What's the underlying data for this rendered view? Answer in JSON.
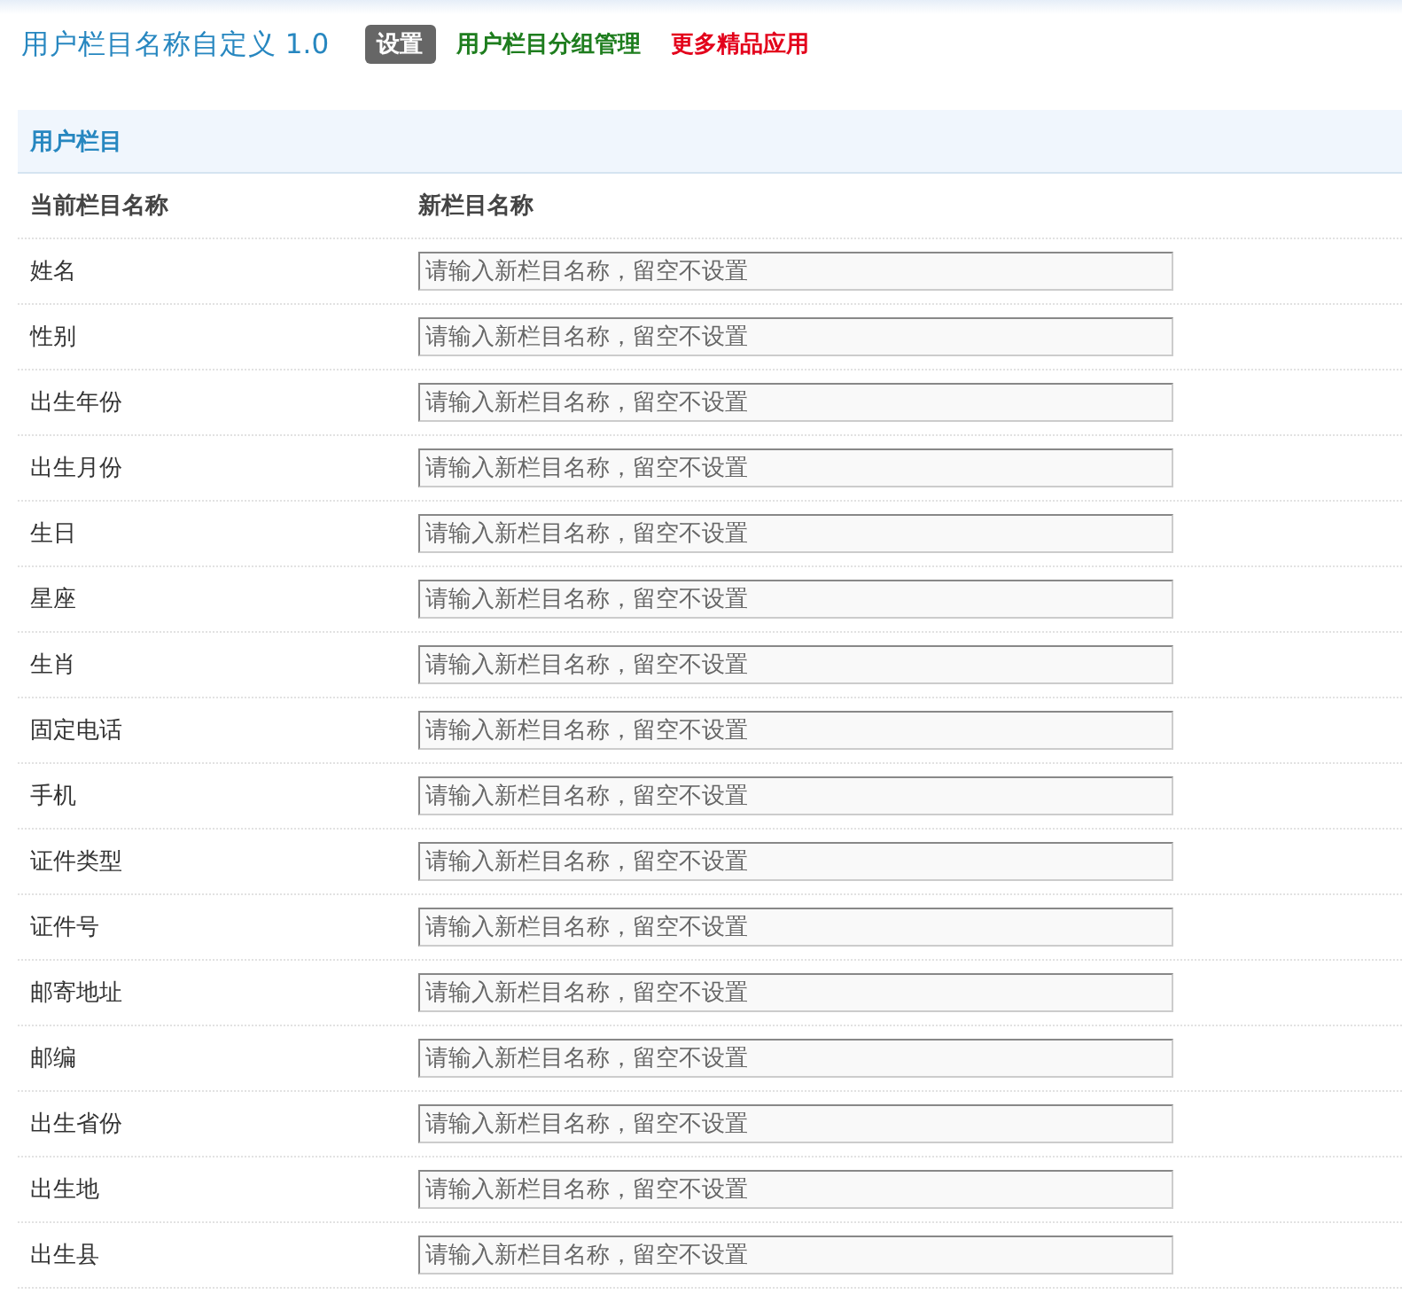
{
  "header": {
    "title": "用户栏目名称自定义 1.0",
    "nav": [
      {
        "label": "设置",
        "selected": true,
        "color": "#666666"
      },
      {
        "label": "用户栏目分组管理",
        "selected": false,
        "color": "#1e7d1e"
      },
      {
        "label": "更多精品应用",
        "selected": false,
        "color": "#e3001b"
      }
    ]
  },
  "section": {
    "title": "用户栏目"
  },
  "table": {
    "columns": [
      "当前栏目名称",
      "新栏目名称"
    ],
    "rows": [
      {
        "name": "姓名",
        "placeholder": "请输入新栏目名称，留空不设置"
      },
      {
        "name": "性别",
        "placeholder": "请输入新栏目名称，留空不设置"
      },
      {
        "name": "出生年份",
        "placeholder": "请输入新栏目名称，留空不设置"
      },
      {
        "name": "出生月份",
        "placeholder": "请输入新栏目名称，留空不设置"
      },
      {
        "name": "生日",
        "placeholder": "请输入新栏目名称，留空不设置"
      },
      {
        "name": "星座",
        "placeholder": "请输入新栏目名称，留空不设置"
      },
      {
        "name": "生肖",
        "placeholder": "请输入新栏目名称，留空不设置"
      },
      {
        "name": "固定电话",
        "placeholder": "请输入新栏目名称，留空不设置"
      },
      {
        "name": "手机",
        "placeholder": "请输入新栏目名称，留空不设置"
      },
      {
        "name": "证件类型",
        "placeholder": "请输入新栏目名称，留空不设置"
      },
      {
        "name": "证件号",
        "placeholder": "请输入新栏目名称，留空不设置"
      },
      {
        "name": "邮寄地址",
        "placeholder": "请输入新栏目名称，留空不设置"
      },
      {
        "name": "邮编",
        "placeholder": "请输入新栏目名称，留空不设置"
      },
      {
        "name": "出生省份",
        "placeholder": "请输入新栏目名称，留空不设置"
      },
      {
        "name": "出生地",
        "placeholder": "请输入新栏目名称，留空不设置"
      },
      {
        "name": "出生县",
        "placeholder": "请输入新栏目名称，留空不设置"
      }
    ]
  }
}
